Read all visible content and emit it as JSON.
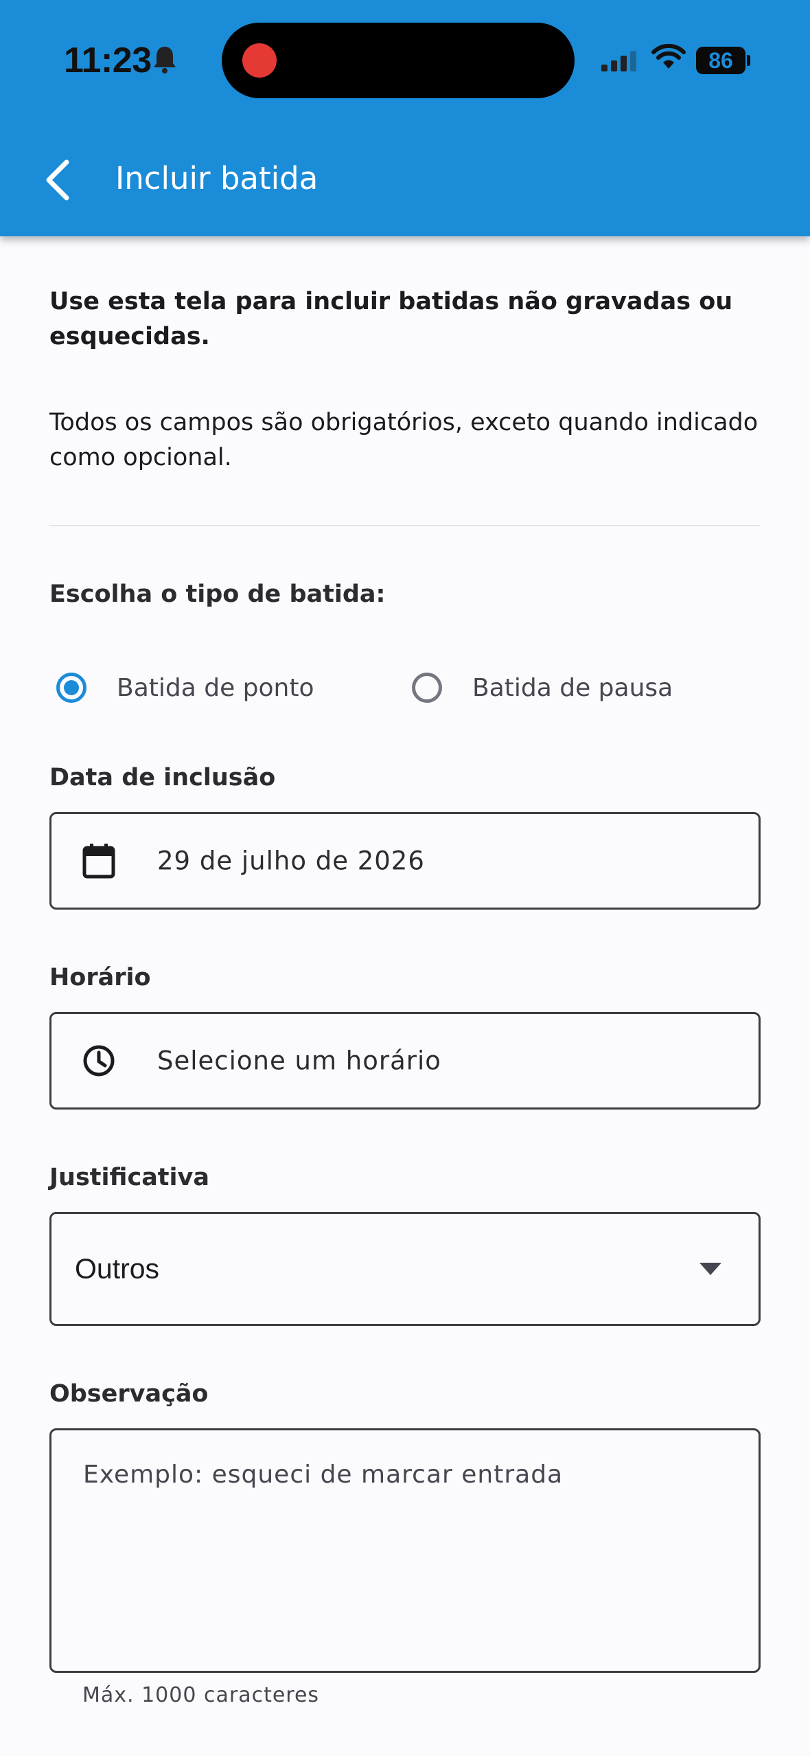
{
  "status_bar": {
    "time": "11:23",
    "battery": "86"
  },
  "header": {
    "title": "Incluir batida"
  },
  "intro_text": "Use esta tela para incluir batidas não gravadas ou esquecidas.",
  "required_note": "Todos os campos são obrigatórios, exceto quando indicado como opcional.",
  "punch_type": {
    "label": "Escolha o tipo de batida:",
    "options": [
      {
        "label": "Batida de ponto",
        "selected": true
      },
      {
        "label": "Batida de pausa",
        "selected": false
      }
    ]
  },
  "date_field": {
    "label": "Data de inclusão",
    "value": "29 de julho de 2026",
    "icon": "calendar-icon"
  },
  "time_field": {
    "label": "Horário",
    "placeholder": "Selecione um horário",
    "icon": "clock-icon"
  },
  "justification": {
    "label": "Justificativa",
    "value": "Outros",
    "icon": "dropdown-arrow-icon"
  },
  "observation": {
    "label": "Observação",
    "placeholder": "Exemplo: esqueci de marcar entrada",
    "helper": "Máx. 1000 caracteres"
  },
  "colors": {
    "primary": "#1B8CD8",
    "background": "#FBFBFE",
    "recording": "#E53935"
  }
}
